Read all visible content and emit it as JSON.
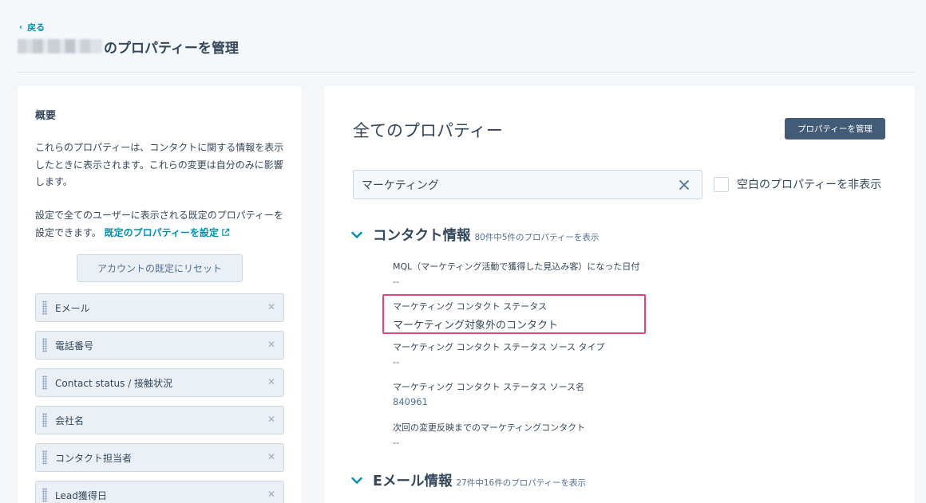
{
  "header": {
    "back_label": "戻る",
    "title_suffix": "のプロパティーを管理"
  },
  "left_panel": {
    "heading": "概要",
    "description": "これらのプロパティーは、コンタクトに関する情報を表示したときに表示されます。これらの変更は自分のみに影響します。",
    "description2": "設定で全てのユーザーに表示される既定のプロパティーを設定できます。",
    "default_link": "既定のプロパティーを設定",
    "reset_button": "アカウントの既定にリセット",
    "properties": [
      "Eメール",
      "電話番号",
      "Contact status / 接触状況",
      "会社名",
      "コンタクト担当者",
      "Lead獲得日"
    ]
  },
  "right_panel": {
    "title": "全てのプロパティー",
    "manage_button": "プロパティーを管理",
    "search": {
      "value": "マーケティング"
    },
    "hide_empty_label": "空白のプロパティーを非表示",
    "sections": [
      {
        "title": "コンタクト情報",
        "count": "80件中5件のプロパティーを表示",
        "fields": [
          {
            "label": "MQL（マーケティング活動で獲得した見込み客）になった日付",
            "value": "--"
          },
          {
            "label": "マーケティング コンタクト ステータス",
            "value": "マーケティング対象外のコンタクト"
          },
          {
            "label": "マーケティング コンタクト ステータス ソース タイプ",
            "value": "--"
          },
          {
            "label": "マーケティング コンタクト ステータス ソース名",
            "value": "840961"
          },
          {
            "label": "次回の変更反映までのマーケティングコンタクト",
            "value": "--"
          }
        ]
      },
      {
        "title": "Eメール情報",
        "count": "27件中16件のプロパティーを表示"
      }
    ]
  },
  "colors": {
    "accent_link": "#0091ae",
    "primary_button": "#425b76",
    "highlight": "#e0457b"
  }
}
